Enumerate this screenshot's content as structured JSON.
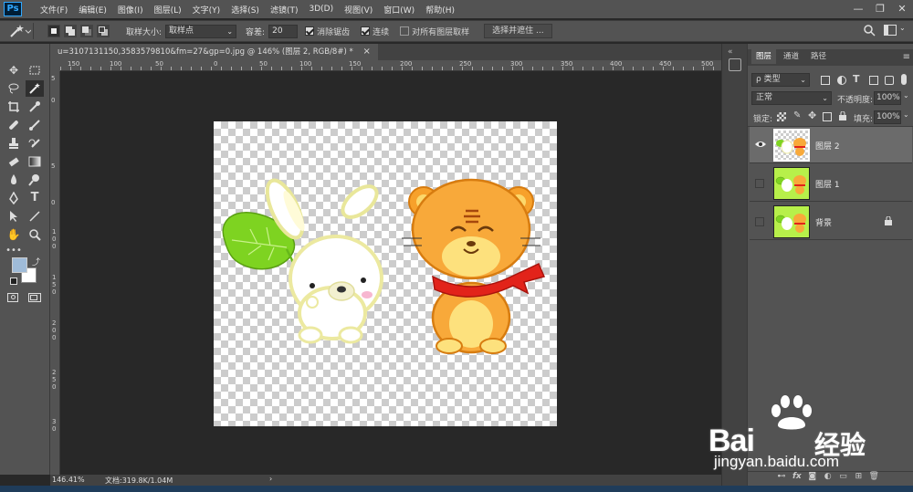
{
  "app": {
    "logo": "Ps"
  },
  "menu": [
    "文件(F)",
    "编辑(E)",
    "图像(I)",
    "图层(L)",
    "文字(Y)",
    "选择(S)",
    "滤镜(T)",
    "3D(D)",
    "视图(V)",
    "窗口(W)",
    "帮助(H)"
  ],
  "window_controls": [
    "—",
    "❐",
    "✕"
  ],
  "options": {
    "sample_size_label": "取样大小:",
    "sample_size_value": "取样点",
    "tolerance_label": "容差:",
    "tolerance_value": "20",
    "antialias_label": "消除锯齿",
    "contiguous_label": "连续",
    "all_layers_label": "对所有图层取样",
    "select_mask_button": "选择并遮住 ..."
  },
  "document": {
    "tab_title": "u=3107131150,3583579810&fm=27&gp=0.jpg @ 146% (图层 2, RGB/8#) *",
    "close": "×"
  },
  "rulers": {
    "h_labels": [
      "150",
      "100",
      "50",
      "0",
      "50",
      "100",
      "150",
      "200",
      "250",
      "300",
      "350",
      "400",
      "450",
      "500"
    ],
    "v_labels": [
      "5",
      "0",
      "5",
      "0",
      "1\n0\n0",
      "1\n5\n0",
      "2\n0\n0",
      "2\n5\n0",
      "3\n0"
    ]
  },
  "status": {
    "zoom": "146.41%",
    "doc": "文档:319.8K/1.04M"
  },
  "layers_panel": {
    "tabs": [
      "图层",
      "通道",
      "路径"
    ],
    "filter_kind": "ρ 类型",
    "blend_mode": "正常",
    "opacity_label": "不透明度:",
    "opacity_value": "100%",
    "lock_label": "锁定:",
    "fill_label": "填充:",
    "fill_value": "100%",
    "layers": [
      {
        "name": "图层 2",
        "visible": true,
        "selected": true
      },
      {
        "name": "图层 1",
        "visible": false,
        "selected": false
      },
      {
        "name": "背景",
        "visible": false,
        "selected": false,
        "locked": true
      }
    ],
    "footer_icons": [
      "link-icon",
      "fx-icon",
      "mask-icon",
      "adjustment-icon",
      "folder-icon",
      "new-layer-icon",
      "trash-icon"
    ]
  },
  "watermark": {
    "brand": "Bai",
    "brand_cn": "经验",
    "url": "jingyan.baidu.com"
  }
}
